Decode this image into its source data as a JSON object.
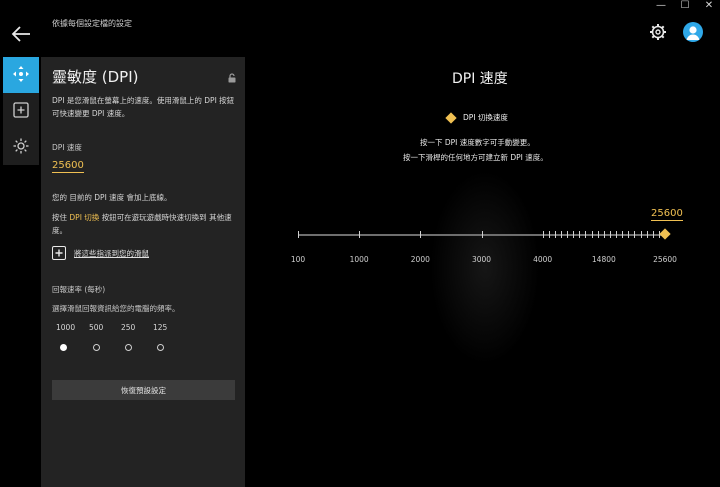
{
  "header": {
    "profile_name": "依據每個設定檔的設定",
    "window_controls": [
      "—",
      "☐",
      "✕"
    ],
    "icons": [
      "back-arrow-icon",
      "gear-icon",
      "user-avatar-icon"
    ]
  },
  "rail": {
    "items": [
      {
        "name": "sensitivity",
        "icon": "move-arrows-icon",
        "active": true
      },
      {
        "name": "assignments",
        "icon": "plus-square-icon",
        "active": false
      },
      {
        "name": "lighting",
        "icon": "sun-icon",
        "active": false
      }
    ]
  },
  "panel": {
    "title": "靈敏度 (DPI)",
    "description": "DPI 是您滑鼠在螢幕上的速度。使用滑鼠上的 DPI 按鈕 可快速變更 DPI 速度。",
    "dpi_label": "DPI 速度",
    "dpi_value": "25600",
    "note_current": "您的 目前的 DPI 速度 會加上底線。",
    "note_switch_prefix": "按住",
    "note_switch_highlight": "DPI 切換",
    "note_switch_suffix": "按鈕可在遊玩遊戲時快速切換到 其他速度。",
    "assign_text": "將這些指派到您的滑鼠",
    "report_rate_title": "回報速率 (每秒)",
    "report_rate_desc": "選擇滑鼠回報資訊給您的電腦的頻率。",
    "report_rates": [
      {
        "label": "1000",
        "selected": true
      },
      {
        "label": "500",
        "selected": false
      },
      {
        "label": "250",
        "selected": false
      },
      {
        "label": "125",
        "selected": false
      }
    ],
    "reset_label": "恢復預設設定"
  },
  "main": {
    "title": "DPI 速度",
    "legend_label": "DPI 切換速度",
    "hint1": "按一下 DPI 速度數字可手動變更。",
    "hint2": "按一下滑桿的任何地方可建立新 DPI 速度。",
    "stage_value": "25600",
    "axis_labels": [
      "100",
      "1000",
      "2000",
      "3000",
      "4000",
      "14800",
      "25600"
    ],
    "accent_color": "#f0c052"
  }
}
